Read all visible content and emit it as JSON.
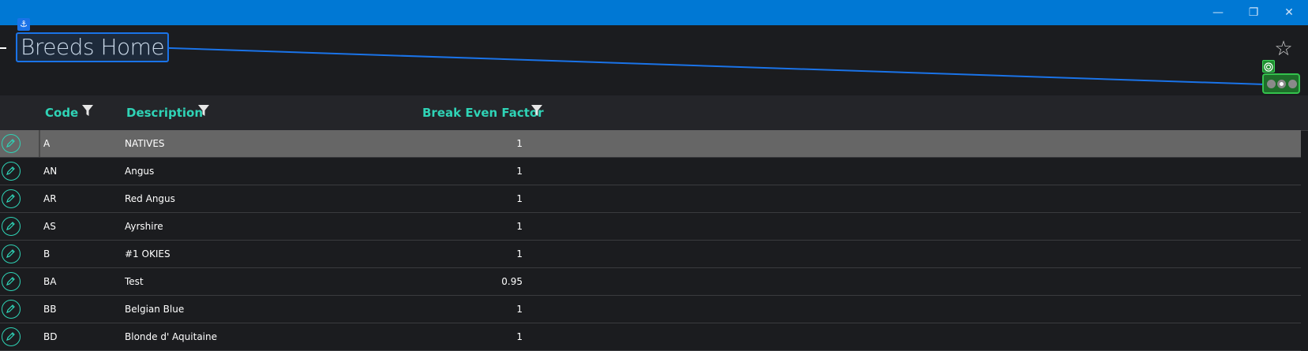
{
  "window": {
    "minimize_glyph": "—",
    "maximize_glyph": "❐",
    "close_glyph": "✕"
  },
  "header": {
    "title": "Breeds Home",
    "anchor_icon": "anchor-icon",
    "star_icon": "star-outline-icon",
    "star_glyph": "☆",
    "anchor_glyph": "⚓"
  },
  "columns": {
    "code": "Code",
    "description": "Description",
    "factor": "Break Even Factor"
  },
  "rows": [
    {
      "code": "A",
      "description": "NATIVES",
      "factor": "1",
      "selected": true
    },
    {
      "code": "AN",
      "description": "Angus",
      "factor": "1"
    },
    {
      "code": "AR",
      "description": "Red Angus",
      "factor": "1"
    },
    {
      "code": "AS",
      "description": "Ayrshire",
      "factor": "1"
    },
    {
      "code": "B",
      "description": "#1 OKIES",
      "factor": "1"
    },
    {
      "code": "BA",
      "description": "Test",
      "factor": "0.95"
    },
    {
      "code": "BB",
      "description": "Belgian Blue",
      "factor": "1"
    },
    {
      "code": "BD",
      "description": "Blonde d' Aquitaine",
      "factor": "1"
    }
  ],
  "colors": {
    "accent": "#2fd3b6",
    "titlebar": "#0078d4",
    "background": "#1b1c1f",
    "selected_row": "#666666"
  }
}
